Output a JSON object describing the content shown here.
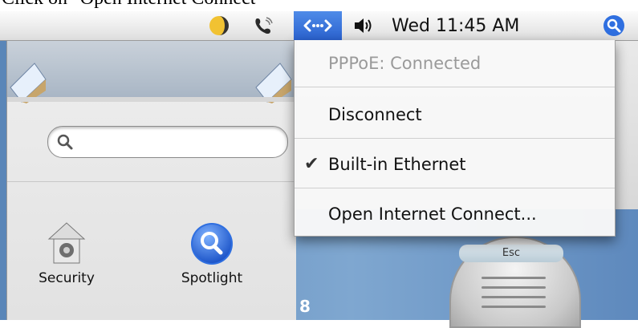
{
  "caption": "Click on \"Open Internet Connect\"",
  "menubar": {
    "clock": "Wed 11:45 AM"
  },
  "window": {
    "prefs": [
      {
        "label": "Security"
      },
      {
        "label": "Spotlight"
      }
    ]
  },
  "menu": {
    "items": [
      {
        "label": "PPPoE: Connected",
        "enabled": false
      },
      {
        "label": "Disconnect",
        "enabled": true
      },
      {
        "label": "Built-in Ethernet",
        "enabled": true,
        "checked": true
      },
      {
        "label": "Open Internet Connect...",
        "enabled": true
      }
    ]
  },
  "keyboard": {
    "esc_label": "Esc"
  },
  "desktop": {
    "number_label": "8"
  },
  "colors": {
    "menu_highlight": "#3b73d9",
    "spotlight_blue": "#2f6fe0"
  }
}
